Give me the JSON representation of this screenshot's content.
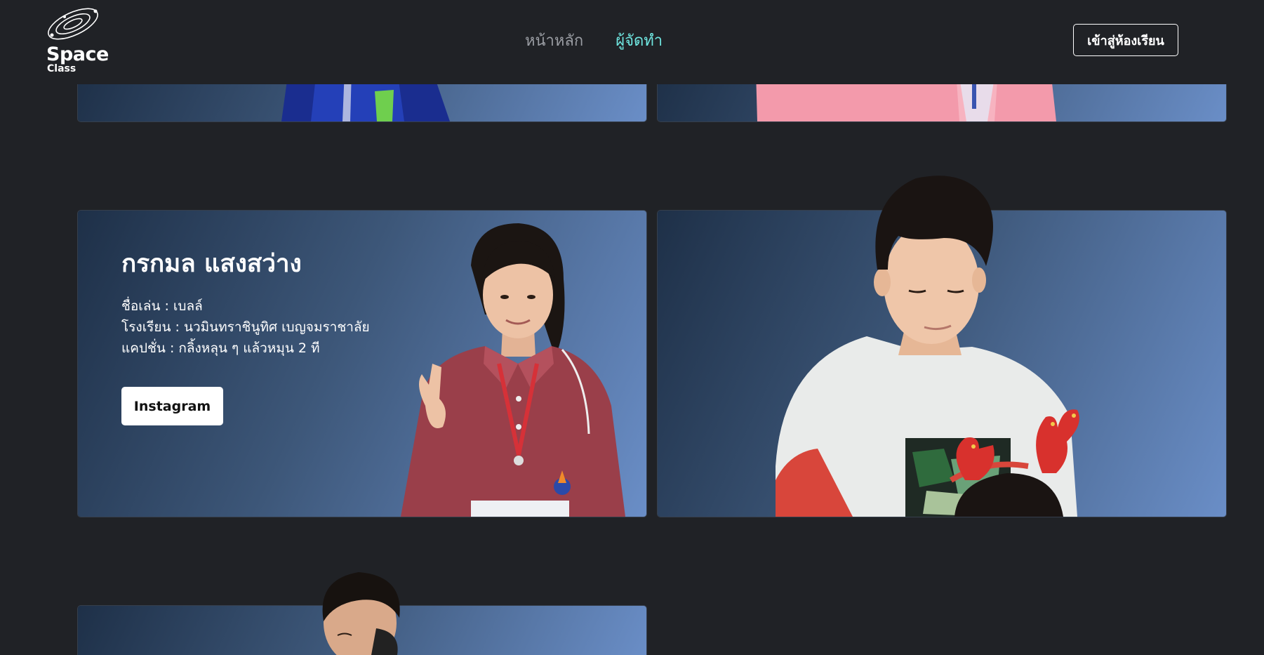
{
  "nav": {
    "logo_word_1": "Space",
    "logo_word_2": "Class",
    "links": [
      {
        "label": "หน้าหลัก",
        "active": false
      },
      {
        "label": "ผู้จัดทำ",
        "active": true
      }
    ],
    "classroom_button": "เข้าสู่ห้องเรียน"
  },
  "members": [
    {
      "name": "กรกมล แสงสว่าง",
      "nickname": "ชื่อเล่น : เบลล์",
      "school": "โรงเรียน : นวมินทราชินูทิศ เบญจมราชาลัย",
      "caption": "แคปชั่น : กลิ้งหลุน ๆ แล้วหมุน 2 ที",
      "button": "Instagram"
    }
  ],
  "colors": {
    "background": "#202226",
    "accent": "#6fe6e0",
    "card_dark": "#1e3048",
    "card_light": "#6a8ec7"
  }
}
